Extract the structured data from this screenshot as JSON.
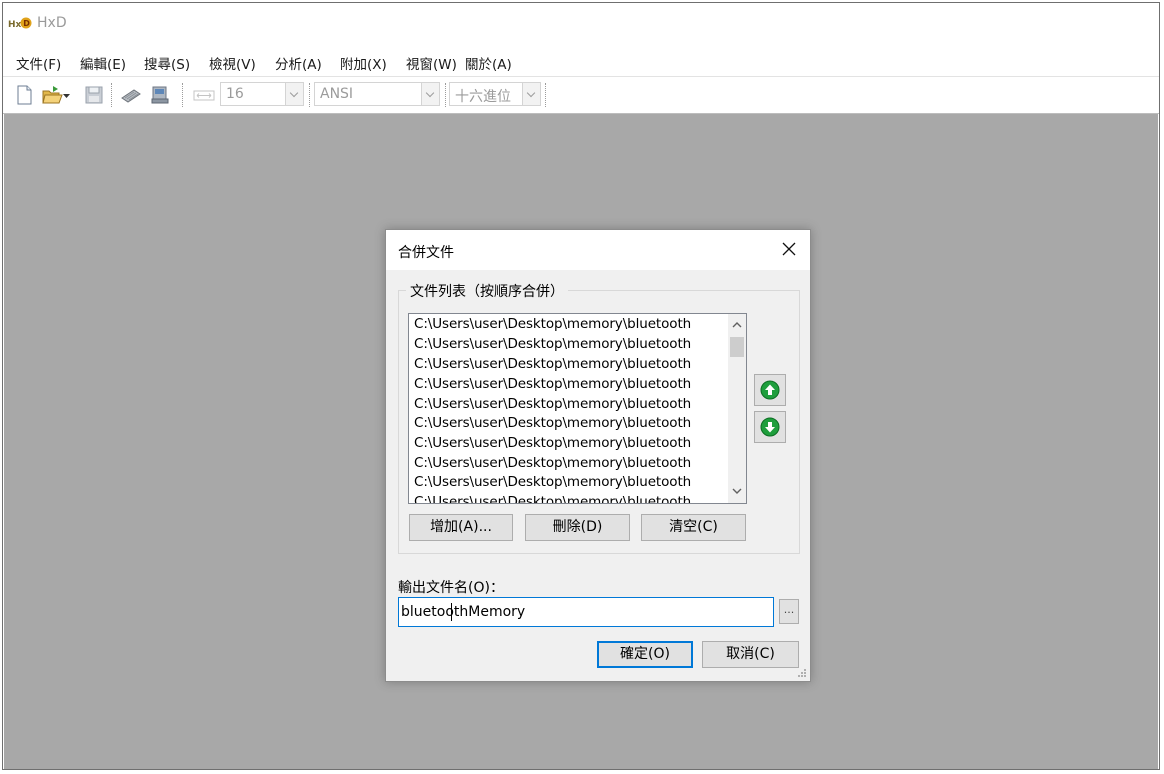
{
  "app": {
    "title": "HxD"
  },
  "menu": [
    "文件(F)",
    "編輯(E)",
    "搜尋(S)",
    "檢視(V)",
    "分析(A)",
    "附加(X)",
    "視窗(W)",
    "關於(A)"
  ],
  "toolbar": {
    "bytes_per_row": "16",
    "charset": "ANSI",
    "offset_base": "十六進位"
  },
  "dialog": {
    "title": "合併文件",
    "group_label": "文件列表（按順序合併）",
    "files": [
      "C:\\Users\\user\\Desktop\\memory\\bluetooth",
      "C:\\Users\\user\\Desktop\\memory\\bluetooth",
      "C:\\Users\\user\\Desktop\\memory\\bluetooth",
      "C:\\Users\\user\\Desktop\\memory\\bluetooth",
      "C:\\Users\\user\\Desktop\\memory\\bluetooth",
      "C:\\Users\\user\\Desktop\\memory\\bluetooth",
      "C:\\Users\\user\\Desktop\\memory\\bluetooth",
      "C:\\Users\\user\\Desktop\\memory\\bluetooth",
      "C:\\Users\\user\\Desktop\\memory\\bluetooth",
      "C:\\Users\\user\\Desktop\\memory\\bluetooth"
    ],
    "add_label": "增加(A)...",
    "delete_label": "刪除(D)",
    "clear_label": "清空(C)",
    "output_label": "輸出文件名(O)：",
    "output_value": "bluetoothMemory",
    "browse_label": "...",
    "ok_label": "確定(O)",
    "cancel_label": "取消(C)"
  },
  "colors": {
    "accent": "#0078d7",
    "workspace": "#a8a8a8",
    "dialog_bg": "#f0f0f0",
    "arrow_button": "#1e9e3c"
  },
  "icons": [
    "new-file-icon",
    "open-folder-icon",
    "save-icon",
    "ram-icon",
    "disk-icon",
    "arrow-up-icon",
    "arrow-down-icon",
    "close-icon"
  ]
}
